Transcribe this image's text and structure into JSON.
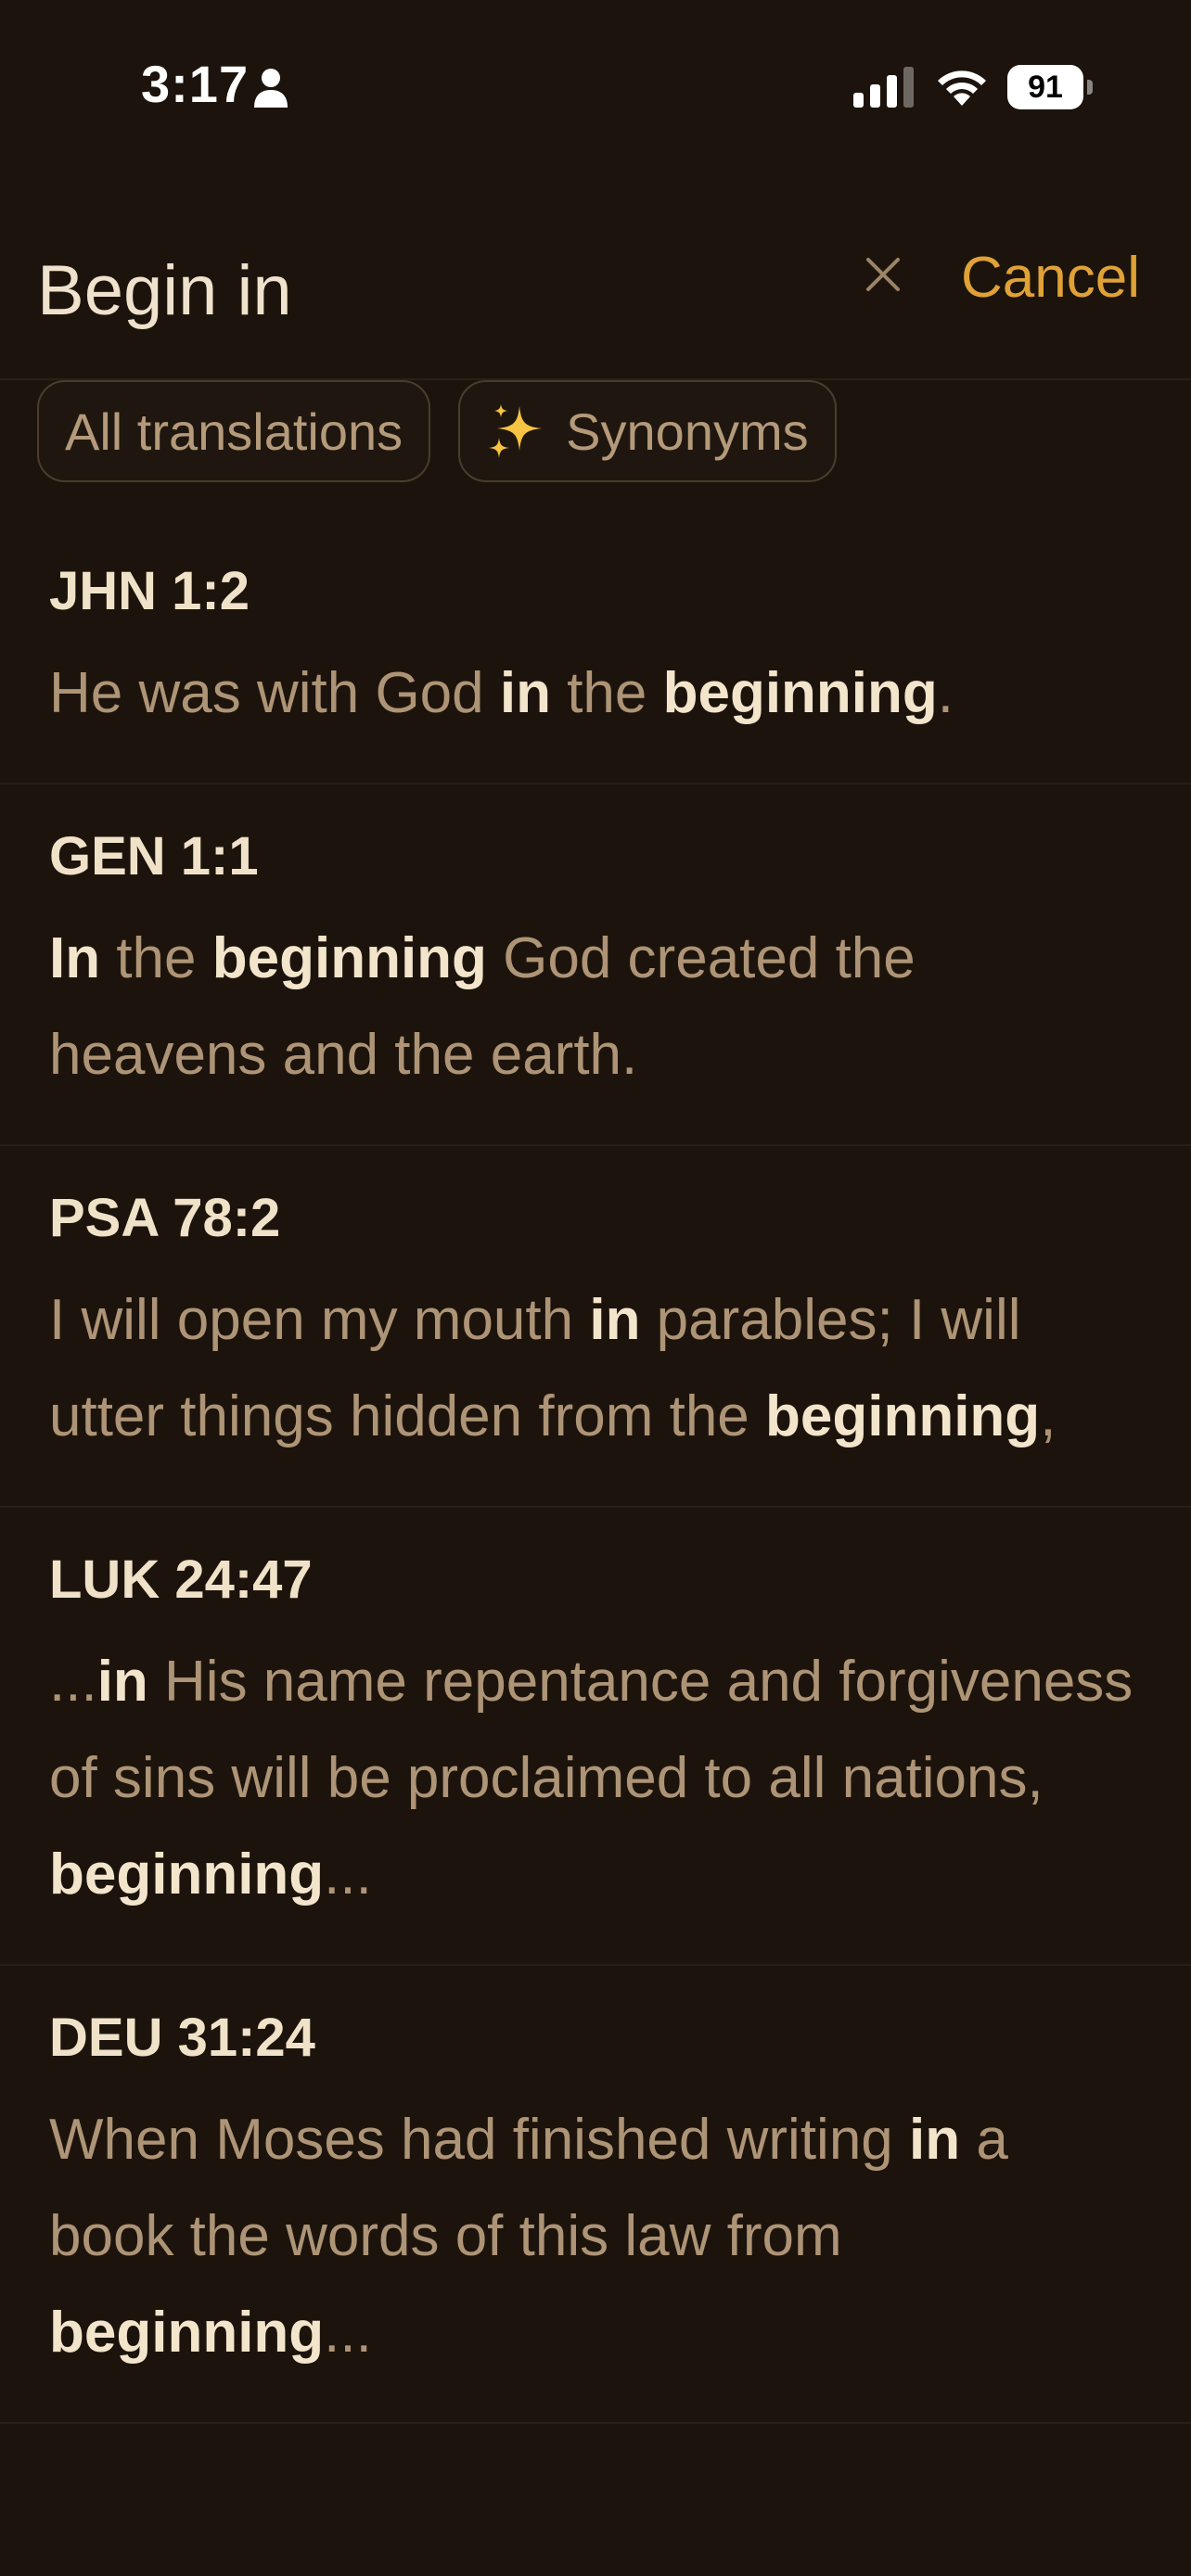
{
  "status_bar": {
    "time": "3:17",
    "battery": "91",
    "icons": [
      "person-icon",
      "cellular-signal-icon",
      "wifi-icon",
      "battery-icon"
    ]
  },
  "search": {
    "query": "Begin in",
    "cancel_label": "Cancel",
    "clear_icon": "close-icon"
  },
  "filters": [
    {
      "label": "All translations"
    },
    {
      "label": "Synonyms",
      "icon": "sparkles-icon"
    }
  ],
  "results": [
    {
      "ref": "JHN 1:2",
      "segments": [
        {
          "t": "He was with God ",
          "b": false
        },
        {
          "t": "in",
          "b": true
        },
        {
          "t": " the ",
          "b": false
        },
        {
          "t": "beginning",
          "b": true
        },
        {
          "t": ".",
          "b": false
        }
      ]
    },
    {
      "ref": "GEN 1:1",
      "segments": [
        {
          "t": "In",
          "b": true
        },
        {
          "t": " the ",
          "b": false
        },
        {
          "t": "beginning",
          "b": true
        },
        {
          "t": " God created the heavens and the earth.",
          "b": false
        }
      ]
    },
    {
      "ref": "PSA 78:2",
      "segments": [
        {
          "t": "I will open my mouth ",
          "b": false
        },
        {
          "t": "in",
          "b": true
        },
        {
          "t": " parables; I will utter things hidden from the ",
          "b": false
        },
        {
          "t": "beginning",
          "b": true
        },
        {
          "t": ",",
          "b": false
        }
      ]
    },
    {
      "ref": "LUK 24:47",
      "segments": [
        {
          "t": "...",
          "b": false
        },
        {
          "t": "in",
          "b": true
        },
        {
          "t": " His name repentance and forgiveness of sins will be proclaimed to all nations, ",
          "b": false
        },
        {
          "t": "beginning",
          "b": true
        },
        {
          "t": "...",
          "b": false
        }
      ]
    },
    {
      "ref": "DEU 31:24",
      "segments": [
        {
          "t": "When Moses had finished writing ",
          "b": false
        },
        {
          "t": "in",
          "b": true
        },
        {
          "t": " a book the words of this law from ",
          "b": false
        },
        {
          "t": "beginning",
          "b": true
        },
        {
          "t": "...",
          "b": false
        }
      ]
    }
  ],
  "colors": {
    "background": "#1c140c",
    "accent": "#e0a236",
    "text_muted": "#ae9476",
    "text_strong": "#f3e5cc"
  }
}
